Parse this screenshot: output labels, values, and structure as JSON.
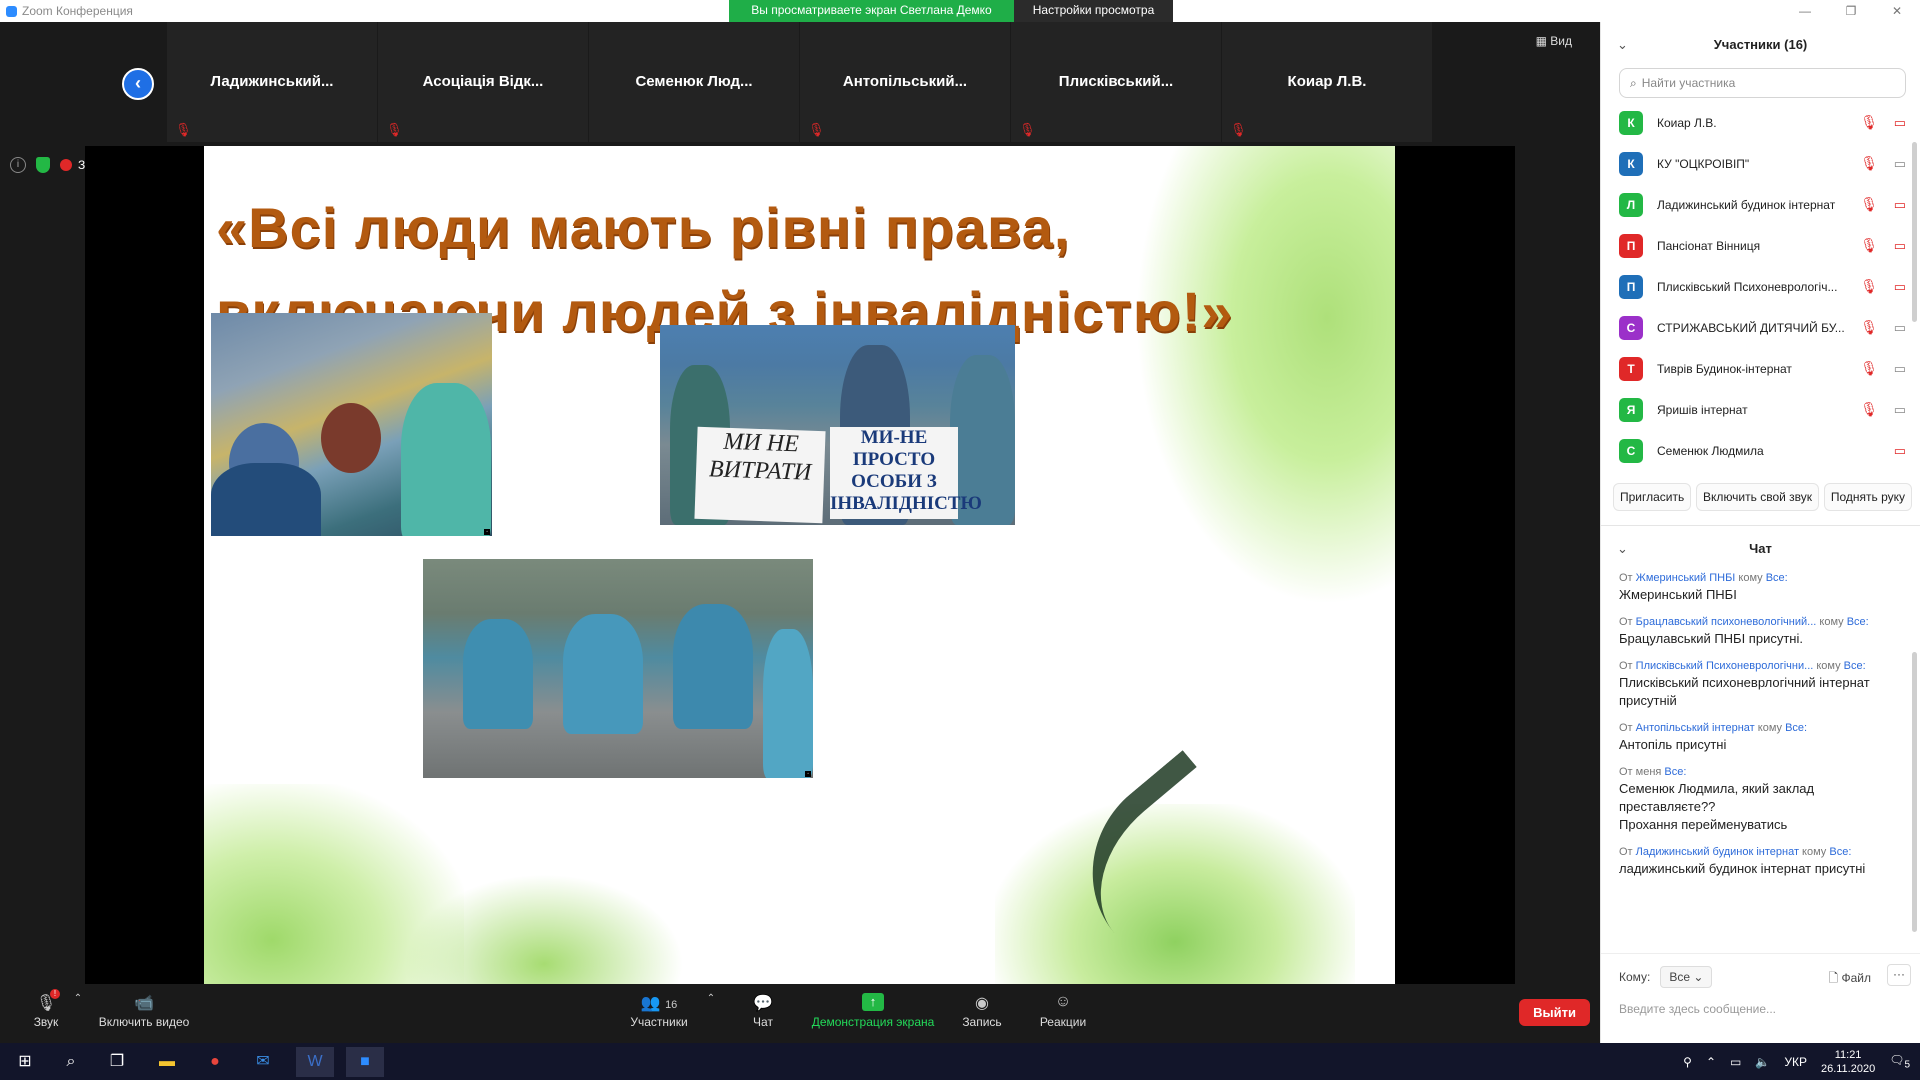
{
  "window": {
    "title": "Zoom Конференция"
  },
  "share_banner": {
    "viewing": "Вы просматриваете экран Светлана Демко",
    "view_settings": "Настройки просмотра ⌄"
  },
  "window_controls": {
    "minimize": "—",
    "restore": "❐",
    "close": "✕"
  },
  "participant_strip": {
    "tiles": [
      {
        "name": "Ладижинський..."
      },
      {
        "name": "Асоціація Відк..."
      },
      {
        "name": "Семенюк  Люд..."
      },
      {
        "name": "Антопільський..."
      },
      {
        "name": "Плисківський..."
      },
      {
        "name": "Коиар Л.В."
      }
    ],
    "view_label": "Вид"
  },
  "status": {
    "record_label": "Запись"
  },
  "slide": {
    "title_line1": "«Всі  люди мають рівні права,",
    "title_line2": "включаючи людей з інвалідністю!»",
    "sign1": "МИ НЕ ВИТРАТИ",
    "sign2": "МИ-НЕ ПРОСТО ОСОБИ З ІНВАЛІДНІСТЮ"
  },
  "toolbar": {
    "audio": "Звук",
    "video": "Включить видео",
    "participants": "Участники",
    "participants_count": "16",
    "chat": "Чат",
    "share": "Демонстрация экрана",
    "record": "Запись",
    "reactions": "Реакции",
    "leave": "Выйти"
  },
  "participants_panel": {
    "title": "Участники (16)",
    "search_placeholder": "Найти участника",
    "items": [
      {
        "initial": "К",
        "name": "Коиар Л.В.",
        "color": "#23b845",
        "mic": "muted",
        "cam": "off"
      },
      {
        "initial": "К",
        "name": "КУ \"ОЦКРОІВІП\"",
        "color": "#1f6fb8",
        "mic": "muted",
        "cam": "on"
      },
      {
        "initial": "Л",
        "name": "Ладижинський будинок інтернат",
        "color": "#23b845",
        "mic": "muted",
        "cam": "off"
      },
      {
        "initial": "П",
        "name": "Пансіонат Вінниця",
        "color": "#e02828",
        "mic": "muted",
        "cam": "off"
      },
      {
        "initial": "П",
        "name": "Плисківський Психоневрологіч...",
        "color": "#1f6fb8",
        "mic": "muted",
        "cam": "off"
      },
      {
        "initial": "С",
        "name": "СТРИЖАВСЬКИЙ ДИТЯЧИЙ БУ...",
        "color": "#9b30c9",
        "mic": "muted",
        "cam": "on"
      },
      {
        "initial": "Т",
        "name": "Тиврів Будинок-інтернат",
        "color": "#e02828",
        "mic": "muted",
        "cam": "on"
      },
      {
        "initial": "Я",
        "name": "Яришів інтернат",
        "color": "#23b845",
        "mic": "muted",
        "cam": "on"
      },
      {
        "initial": "С",
        "name": "Семенюк Людмила",
        "color": "#23b845",
        "mic": "none",
        "cam": "off"
      }
    ],
    "buttons": {
      "invite": "Пригласить",
      "unmute": "Включить свой звук",
      "raise_hand": "Поднять руку"
    }
  },
  "chat_panel": {
    "title": "Чат",
    "messages": [
      {
        "from_prefix": "От ",
        "from": "Жмеринський ПНБІ",
        "to_prefix": " кому ",
        "to": "Все:",
        "text": "Жмеринський ПНБІ"
      },
      {
        "from_prefix": "От ",
        "from": "Брацлавський психоневологічний...",
        "to_prefix": " кому ",
        "to": "Все:",
        "text": "Брацулавський ПНБІ присутні."
      },
      {
        "from_prefix": "От ",
        "from": "Плисківський Психоневрологічни...",
        "to_prefix": " кому ",
        "to": "Все:",
        "text": "Плисківський психоневрлогічний інтернат присутній"
      },
      {
        "from_prefix": "От ",
        "from": "Антопільський інтернат",
        "to_prefix": " кому ",
        "to": "Все:",
        "text": "Антопіль присутні"
      },
      {
        "from_prefix": "От меня ",
        "from": "",
        "to_prefix": "",
        "to": "Все:",
        "text": "Семенюк Людмила, який заклад преставляєте??\nПрохання перейменуватись"
      },
      {
        "from_prefix": "От ",
        "from": "Ладижинський будинок інтернат",
        "to_prefix": " кому ",
        "to": "Все:",
        "text": "ладижинський будинок інтернат присутні"
      }
    ],
    "to_label": "Кому:",
    "to_value": "Все",
    "file_label": "Файл",
    "more_label": "···",
    "input_placeholder": "Введите здесь сообщение..."
  },
  "taskbar": {
    "language": "УКР",
    "time": "11:21",
    "date": "26.11.2020",
    "notifications": "5"
  }
}
